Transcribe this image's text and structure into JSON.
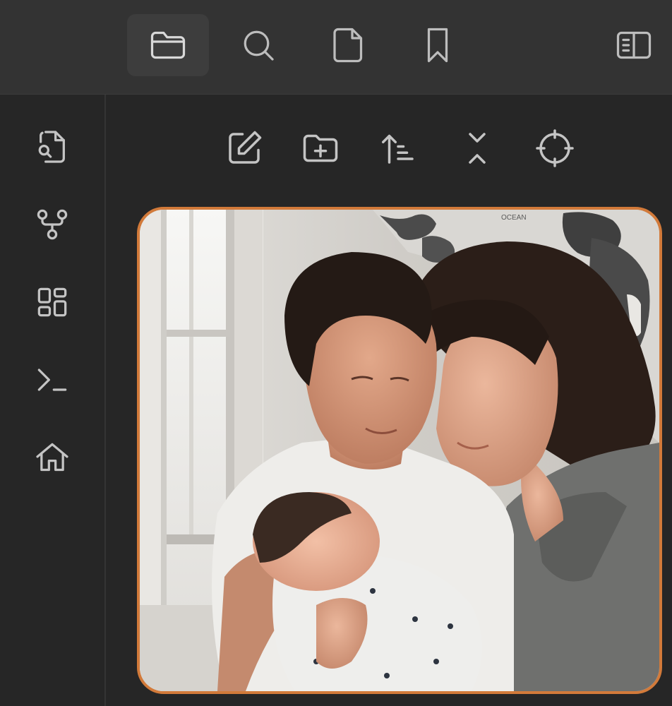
{
  "window": {
    "accent_color": "#d27a3a"
  },
  "top_tabs": [
    {
      "name": "files",
      "icon": "folder-icon",
      "active": true
    },
    {
      "name": "search",
      "icon": "search-icon",
      "active": false
    },
    {
      "name": "file",
      "icon": "file-icon",
      "active": false
    },
    {
      "name": "bookmarks",
      "icon": "bookmark-icon",
      "active": false
    }
  ],
  "right_toggle": {
    "icon": "sidebar-toggle-icon"
  },
  "ribbon": [
    {
      "icon": "file-search-icon"
    },
    {
      "icon": "git-fork-icon"
    },
    {
      "icon": "layout-dashboard-icon"
    },
    {
      "icon": "terminal-icon"
    },
    {
      "icon": "home-icon"
    }
  ],
  "explorer_toolbar": [
    {
      "icon": "edit-icon",
      "action": "new-note"
    },
    {
      "icon": "folder-plus-icon",
      "action": "new-folder"
    },
    {
      "icon": "sort-icon",
      "action": "sort"
    },
    {
      "icon": "collapse-icon",
      "action": "collapse-all"
    },
    {
      "icon": "locate-icon",
      "action": "reveal-file"
    }
  ],
  "photo": {
    "description_icon": "family-photo",
    "border_color": "#d27a3a",
    "map_label": "OCEAN"
  }
}
